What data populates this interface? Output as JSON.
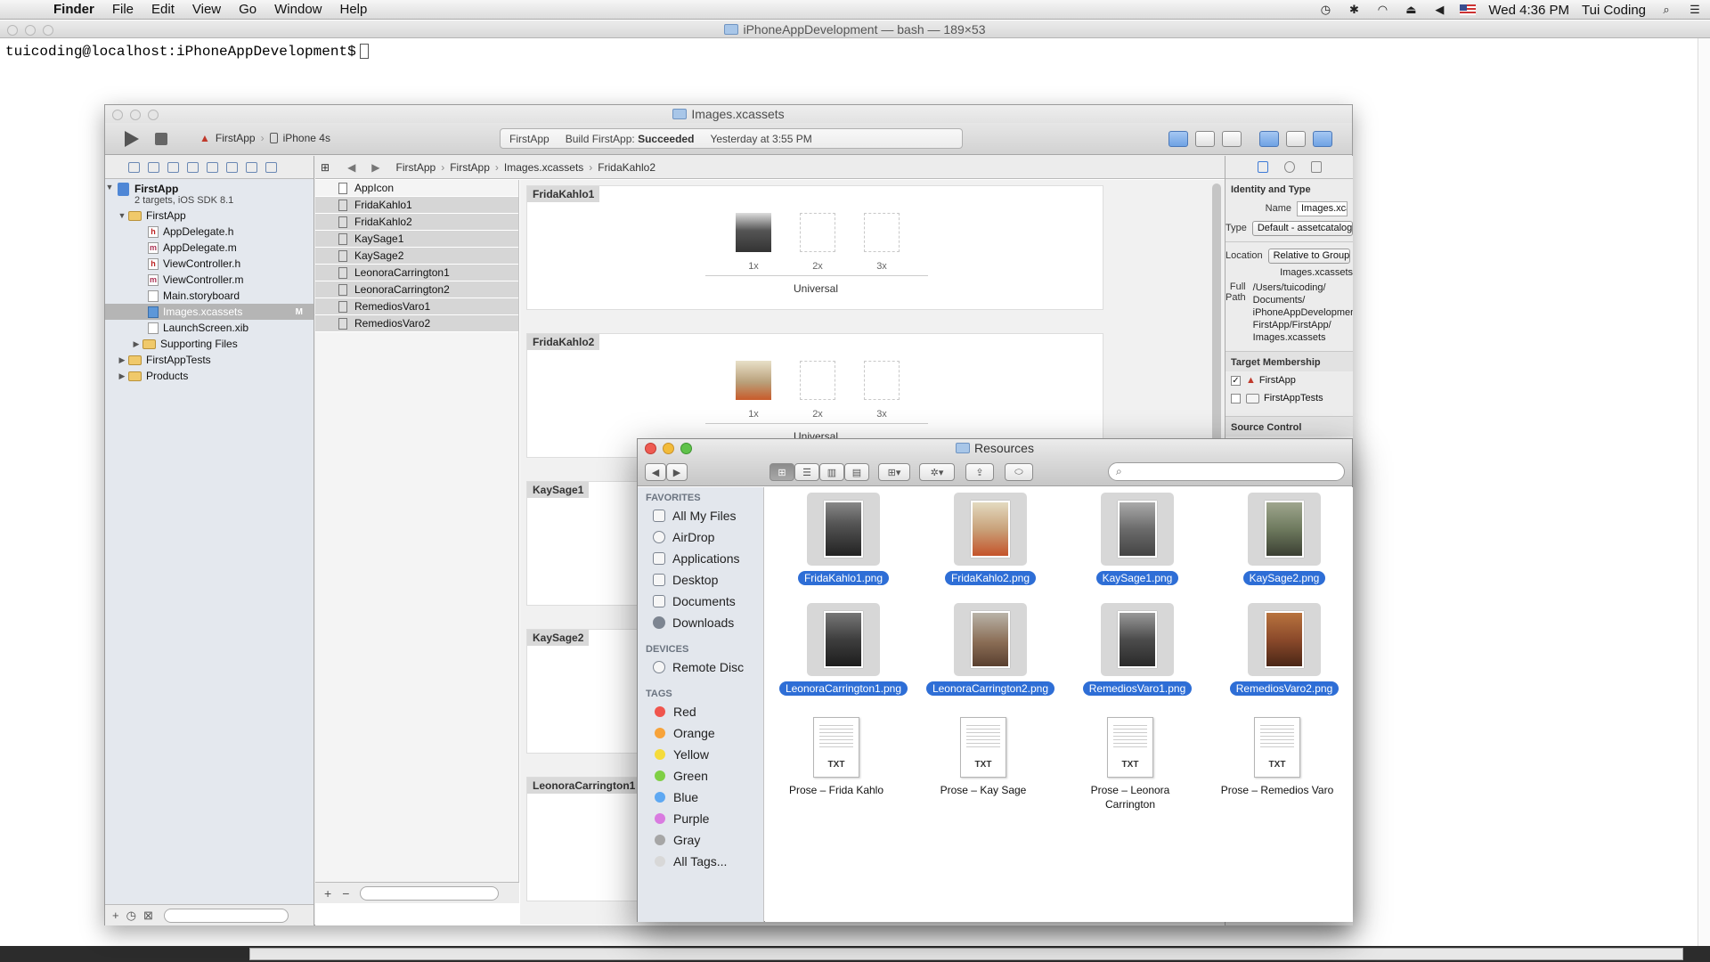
{
  "menubar": {
    "app": "Finder",
    "items": [
      "File",
      "Edit",
      "View",
      "Go",
      "Window",
      "Help"
    ],
    "clock": "Wed 4:36 PM",
    "user": "Tui Coding"
  },
  "terminal": {
    "title": "iPhoneAppDevelopment — bash — 189×53",
    "prompt": "tuicoding@localhost:iPhoneAppDevelopment$"
  },
  "xcode": {
    "title": "Images.xcassets",
    "scheme": "FirstApp",
    "device": "iPhone 4s",
    "activity": {
      "target": "FirstApp",
      "build_label": "Build FirstApp:",
      "build_status": "Succeeded",
      "time": "Yesterday at 3:55 PM"
    },
    "navigator": [
      {
        "label": "FirstApp",
        "sub": "2 targets, iOS SDK 8.1",
        "kind": "project"
      },
      {
        "label": "FirstApp",
        "kind": "folder"
      },
      {
        "label": "AppDelegate.h",
        "kind": "h"
      },
      {
        "label": "AppDelegate.m",
        "kind": "m"
      },
      {
        "label": "ViewController.h",
        "kind": "h"
      },
      {
        "label": "ViewController.m",
        "kind": "m"
      },
      {
        "label": "Main.storyboard",
        "kind": "file"
      },
      {
        "label": "Images.xcassets",
        "kind": "assets",
        "badge": "M"
      },
      {
        "label": "LaunchScreen.xib",
        "kind": "file"
      },
      {
        "label": "Supporting Files",
        "kind": "folder"
      },
      {
        "label": "FirstAppTests",
        "kind": "folder"
      },
      {
        "label": "Products",
        "kind": "folder"
      }
    ],
    "jumpbar": [
      "FirstApp",
      "FirstApp",
      "Images.xcassets",
      "FridaKahlo2"
    ],
    "assets": [
      "AppIcon",
      "FridaKahlo1",
      "FridaKahlo2",
      "KaySage1",
      "KaySage2",
      "LeonoraCarrington1",
      "LeonoraCarrington2",
      "RemediosVaro1",
      "RemediosVaro2"
    ],
    "sets": [
      {
        "name": "FridaKahlo1",
        "scales": [
          "1x",
          "2x",
          "3x"
        ],
        "idiom": "Universal"
      },
      {
        "name": "FridaKahlo2",
        "scales": [
          "1x",
          "2x",
          "3x"
        ],
        "idiom": "Universal"
      },
      {
        "name": "KaySage1"
      },
      {
        "name": "KaySage2"
      },
      {
        "name": "LeonoraCarrington1"
      }
    ],
    "inspector": {
      "section": "Identity and Type",
      "name_label": "Name",
      "name_value": "Images.xcassets",
      "type_label": "Type",
      "type_value": "Default - assetcatalog",
      "location_label": "Location",
      "location_value": "Relative to Group",
      "location_file": "Images.xcassets",
      "fullpath_label": "Full Path",
      "fullpath_lines": [
        "/Users/tuicoding/",
        "Documents/",
        "iPhoneAppDevelopment/",
        "FirstApp/FirstApp/",
        "Images.xcassets"
      ],
      "membership_section": "Target Membership",
      "targets": [
        "FirstApp",
        "FirstAppTests"
      ],
      "source_control": "Source Control"
    }
  },
  "finder": {
    "title": "Resources",
    "favorites_header": "FAVORITES",
    "favorites": [
      "All My Files",
      "AirDrop",
      "Applications",
      "Desktop",
      "Documents",
      "Downloads"
    ],
    "devices_header": "DEVICES",
    "devices": [
      "Remote Disc"
    ],
    "tags_header": "TAGS",
    "tags": [
      {
        "name": "Red",
        "color": "#f0554d"
      },
      {
        "name": "Orange",
        "color": "#f7a33a"
      },
      {
        "name": "Yellow",
        "color": "#f5db3b"
      },
      {
        "name": "Green",
        "color": "#7fcf45"
      },
      {
        "name": "Blue",
        "color": "#5ea8f2"
      },
      {
        "name": "Purple",
        "color": "#d97be0"
      },
      {
        "name": "Gray",
        "color": "#a6a6a6"
      },
      {
        "name": "All Tags...",
        "color": "#d8d8d8"
      }
    ],
    "images": [
      {
        "name": "FridaKahlo1.png",
        "tone": "#555"
      },
      {
        "name": "FridaKahlo2.png",
        "tone": "#c9a27a"
      },
      {
        "name": "KaySage1.png",
        "tone": "#6b6b6b"
      },
      {
        "name": "KaySage2.png",
        "tone": "#6e7a5e"
      },
      {
        "name": "LeonoraCarrington1.png",
        "tone": "#3e3e3e"
      },
      {
        "name": "LeonoraCarrington2.png",
        "tone": "#8a6d55"
      },
      {
        "name": "RemediosVaro1.png",
        "tone": "#4c4c4c"
      },
      {
        "name": "RemediosVaro2.png",
        "tone": "#8b4a2b"
      }
    ],
    "docs": [
      {
        "ext": "TXT",
        "name": "Prose – Frida Kahlo"
      },
      {
        "ext": "TXT",
        "name": "Prose – Kay Sage"
      },
      {
        "ext": "TXT",
        "name": "Prose – Leonora Carrington"
      },
      {
        "ext": "TXT",
        "name": "Prose – Remedios Varo"
      }
    ]
  }
}
